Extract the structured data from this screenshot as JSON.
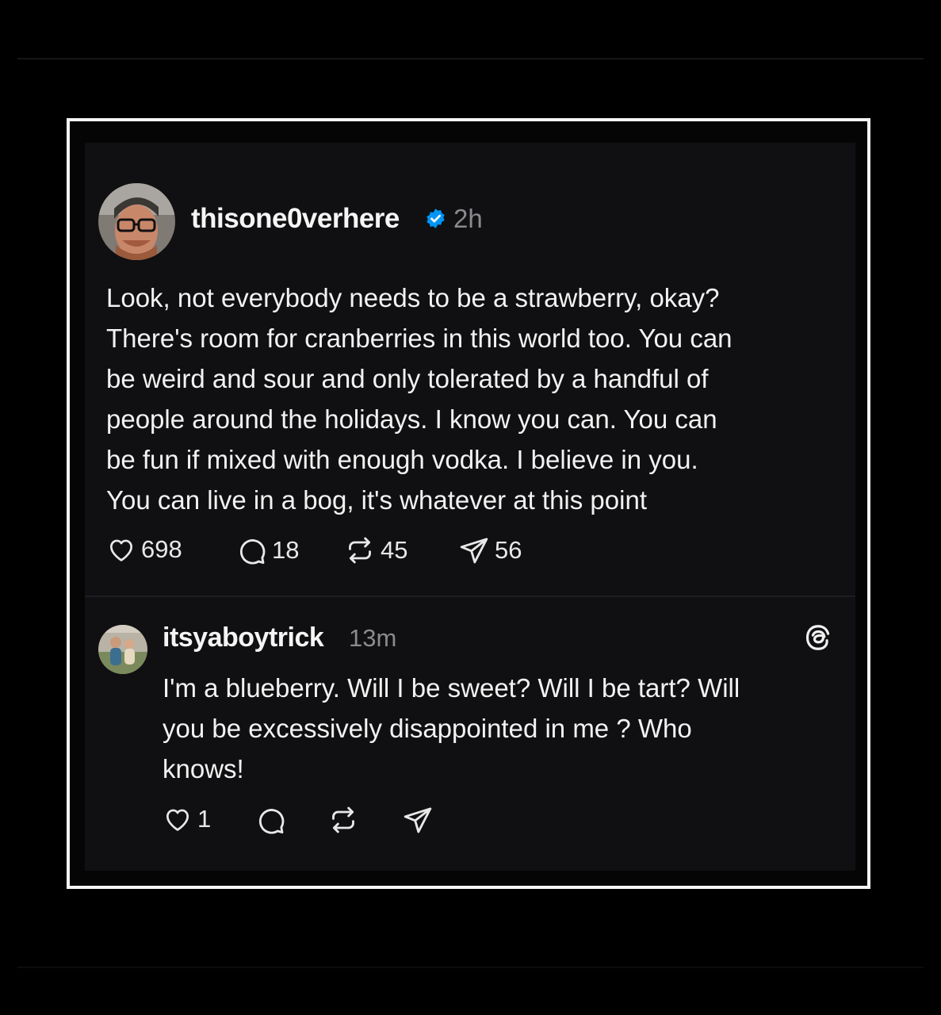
{
  "post": {
    "username": "thisone0verhere",
    "verified_icon": "verified-badge-icon",
    "timestamp": "2h",
    "body_lines": [
      "Look, not everybody needs to be a strawberry, okay?",
      "There's room for cranberries in this world too. You can",
      "be weird and sour and only tolerated by a handful of",
      "people around the holidays. I know you can. You can",
      "be fun if mixed with enough vodka. I believe in you.",
      "You can live in a bog, it's whatever at this point"
    ],
    "actions": {
      "likes": "698",
      "replies": "18",
      "reposts": "45",
      "shares": "56"
    }
  },
  "reply": {
    "username": "itsyaboytrick",
    "timestamp": "13m",
    "body_lines": [
      "I'm a blueberry. Will I be sweet? Will I be tart? Will",
      "you be excessively disappointed in me ? Who",
      "knows!"
    ],
    "actions": {
      "likes": "1"
    }
  },
  "icons": {
    "like": "heart-icon",
    "reply": "comment-bubble-icon",
    "repost": "repost-icon",
    "share": "send-icon",
    "app": "threads-logo-icon"
  },
  "colors": {
    "background": "#000000",
    "card": "#101012",
    "frame_border": "#f5f5f5",
    "verified": "#0095f6",
    "muted_text": "#8a8a8f"
  }
}
